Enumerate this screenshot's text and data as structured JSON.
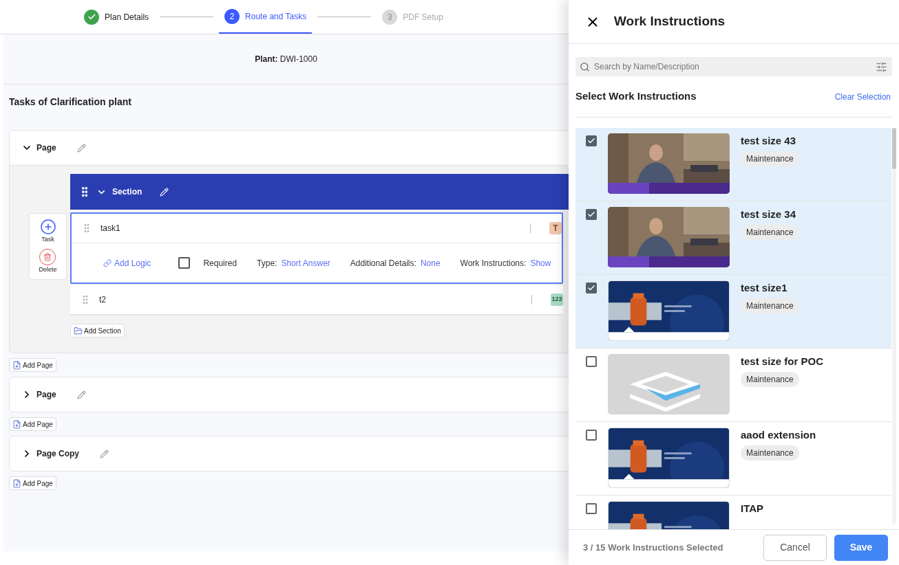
{
  "stepper": {
    "steps": [
      {
        "label": "Plan Details",
        "completed": true,
        "selected": false
      },
      {
        "number": "2",
        "label": "Route and Tasks",
        "completed": false,
        "selected": true
      },
      {
        "number": "3",
        "label": "PDF Setup",
        "completed": false,
        "selected": false
      }
    ]
  },
  "plant": {
    "label": "Plant:",
    "value": "DWI-1000"
  },
  "tasks_title": "Tasks of Clarification plant",
  "task_toolbar": [
    {
      "kind": "add",
      "label": "Task"
    },
    {
      "kind": "delete",
      "label": "Delete"
    }
  ],
  "pages": [
    {
      "title": "Page",
      "expanded": true,
      "add_page": "Add Page",
      "add_section": "Add Section",
      "sections": [
        {
          "title": "Section",
          "expanded": true,
          "tasks": [
            {
              "name": "task1",
              "selected": true,
              "badge": {
                "kind": "text",
                "text": "T"
              },
              "details": {
                "add_logic": "Add Logic",
                "required": {
                  "label": "Required",
                  "checked": false
                },
                "fields": [
                  {
                    "label": "Type:",
                    "value": "Short Answer"
                  },
                  {
                    "label": "Additional Details:",
                    "value": "None"
                  },
                  {
                    "label": "Work Instructions:",
                    "value": "Show"
                  }
                ]
              }
            },
            {
              "name": "t2",
              "selected": false,
              "badge": {
                "kind": "number",
                "text": "123"
              }
            }
          ]
        }
      ]
    },
    {
      "title": "Page",
      "expanded": false,
      "add_page": "Add Page"
    },
    {
      "title": "Page Copy",
      "expanded": false,
      "add_page": "Add Page"
    }
  ],
  "drawer": {
    "title": "Work Instructions",
    "search": {
      "placeholder": "Search by Name/Description"
    },
    "heading": "Select Work Instructions",
    "clear_selection": "Clear Selection",
    "items": [
      {
        "title": "test size 43",
        "tag": "Maintenance",
        "checked": true,
        "thumbnail": {
          "kind": "person"
        }
      },
      {
        "title": "test size 34",
        "tag": "Maintenance",
        "checked": true,
        "thumbnail": {
          "kind": "person"
        }
      },
      {
        "title": "test size1",
        "tag": "Maintenance",
        "checked": true,
        "thumbnail": {
          "kind": "pump"
        }
      },
      {
        "title": "test size for POC",
        "tag": "Maintenance",
        "checked": false,
        "thumbnail": {
          "kind": "placeholder"
        }
      },
      {
        "title": "aaod extension",
        "tag": "Maintenance",
        "checked": false,
        "thumbnail": {
          "kind": "pump"
        }
      },
      {
        "title": "ITAP",
        "checked": false,
        "thumbnail": {
          "kind": "pump"
        }
      }
    ],
    "selected_count": "3 / 15 Work Instructions Selected",
    "cancel": "Cancel",
    "save": "Save"
  }
}
